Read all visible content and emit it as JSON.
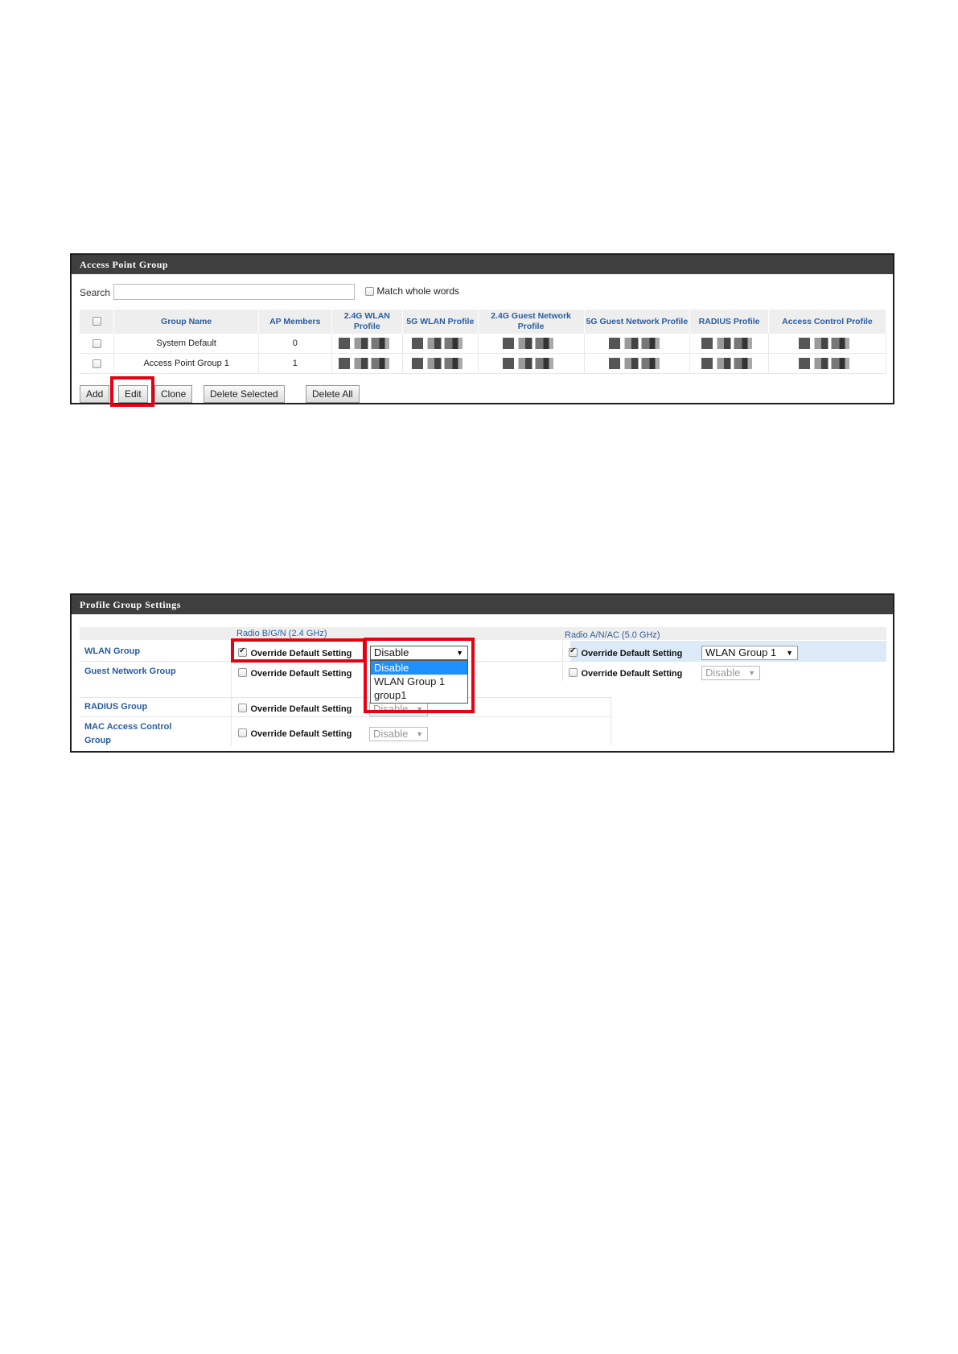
{
  "ap_group": {
    "title": "Access Point Group",
    "search_label": "Search",
    "search_value": "",
    "match_label": "Match whole words",
    "columns": [
      "Group Name",
      "AP Members",
      "2.4G WLAN Profile",
      "5G WLAN Profile",
      "2.4G Guest Network Profile",
      "5G Guest Network Profile",
      "RADIUS Profile",
      "Access Control Profile"
    ],
    "rows": [
      {
        "name": "System Default",
        "members": "0"
      },
      {
        "name": "Access Point Group 1",
        "members": "1"
      }
    ],
    "buttons": {
      "add": "Add",
      "edit": "Edit",
      "clone": "Clone",
      "delete_selected": "Delete Selected",
      "delete_all": "Delete All"
    }
  },
  "profile_group": {
    "title": "Profile Group Settings",
    "radio_24": "Radio B/G/N (2.4 GHz)",
    "radio_5": "Radio A/N/AC (5.0 GHz)",
    "override_label": "Override Default Setting",
    "rows": {
      "wlan": "WLAN Group",
      "guest": "Guest Network Group",
      "radius": "RADIUS Group",
      "mac": "MAC Access Control Group"
    },
    "wlan_24_value": "Disable",
    "wlan_5_value": "WLAN Group 1",
    "guest_5_value": "Disable",
    "radius_24_value": "Disable",
    "mac_24_value": "Disable",
    "dropdown_options": [
      "Disable",
      "WLAN Group 1",
      "group1"
    ],
    "dropdown_selected": "Disable"
  },
  "colors": {
    "highlight_red": "#e60012",
    "header_dark": "#3f3f3f",
    "link_blue": "#2a5d9f",
    "option_selected": "#1e90ff"
  }
}
